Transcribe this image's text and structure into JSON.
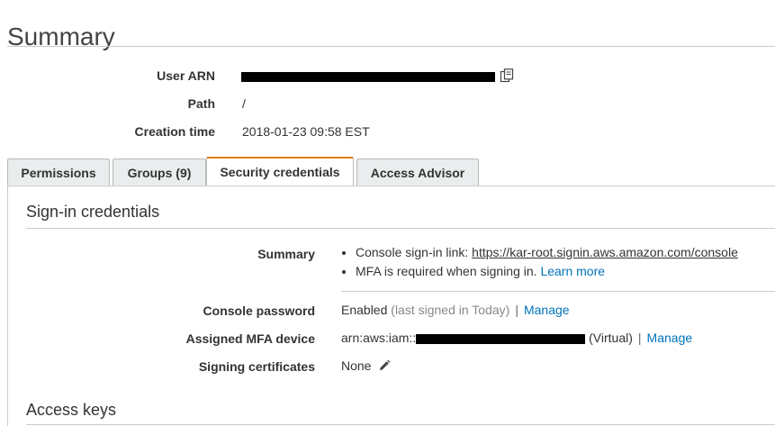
{
  "page": {
    "title": "Summary"
  },
  "summary": {
    "user_arn_label": "User ARN",
    "path_label": "Path",
    "path_value": "/",
    "creation_time_label": "Creation time",
    "creation_time_value": "2018-01-23 09:58 EST"
  },
  "tabs": [
    {
      "label": "Permissions"
    },
    {
      "label": "Groups (9)"
    },
    {
      "label": "Security credentials"
    },
    {
      "label": "Access Advisor"
    }
  ],
  "active_tab": "Security credentials",
  "signin": {
    "section_title": "Sign-in credentials",
    "summary_label": "Summary",
    "console_link_prefix": "Console sign-in link: ",
    "console_link_url": "https://kar-root.signin.aws.amazon.com/console",
    "mfa_text": "MFA is required when signing in. ",
    "learn_more": "Learn more",
    "console_password_label": "Console password",
    "console_password_status": "Enabled",
    "console_password_note": "(last signed in Today)",
    "manage_label": "Manage",
    "mfa_label": "Assigned MFA device",
    "mfa_prefix": "arn:aws:iam::",
    "mfa_suffix": "(Virtual)",
    "signing_certs_label": "Signing certificates",
    "signing_certs_value": "None"
  },
  "access_keys": {
    "section_title": "Access keys"
  },
  "icons": {
    "copy": "copy-icon",
    "pencil": "pencil-icon"
  },
  "colors": {
    "tab_accent": "#e07b1a",
    "link": "#0073bb"
  }
}
